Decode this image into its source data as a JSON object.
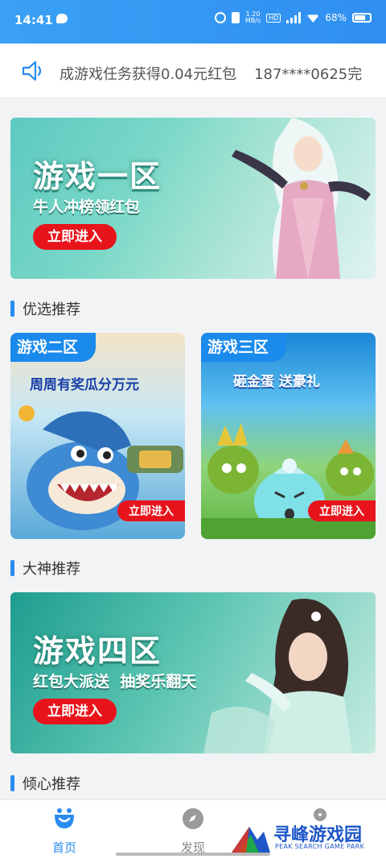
{
  "status_bar": {
    "time": "14:41",
    "net_speed": "1.20\nMB/s",
    "hd": "HD",
    "network": "4G",
    "battery": "68%"
  },
  "notice": {
    "text_a": "成游戏任务获得0.04元红包",
    "text_b": "187****0625完"
  },
  "banner1": {
    "title": "游戏一区",
    "subtitle": "牛人冲榜领红包",
    "button": "立即进入"
  },
  "section2": {
    "title": "优选推荐"
  },
  "card2": {
    "tag": "游戏二区",
    "slogan": "周周有奖瓜分万元",
    "button": "立即进入"
  },
  "card3": {
    "tag": "游戏三区",
    "slogan": "砸金蛋 送豪礼",
    "button": "立即进入"
  },
  "section3": {
    "title": "大神推荐"
  },
  "banner4": {
    "title": "游戏四区",
    "subtitle": "红包大派送  抽奖乐翻天",
    "button": "立即进入"
  },
  "section4": {
    "title": "倾心推荐"
  },
  "nav": {
    "home": "首页",
    "discover": "发现"
  },
  "watermark": {
    "name": "寻峰游戏园",
    "sub": "PEAK SEARCH GAME PARK"
  },
  "colors": {
    "accent": "#2a8cf0",
    "button_red": "#e8141c",
    "status_bar": "#3aa0f5"
  }
}
